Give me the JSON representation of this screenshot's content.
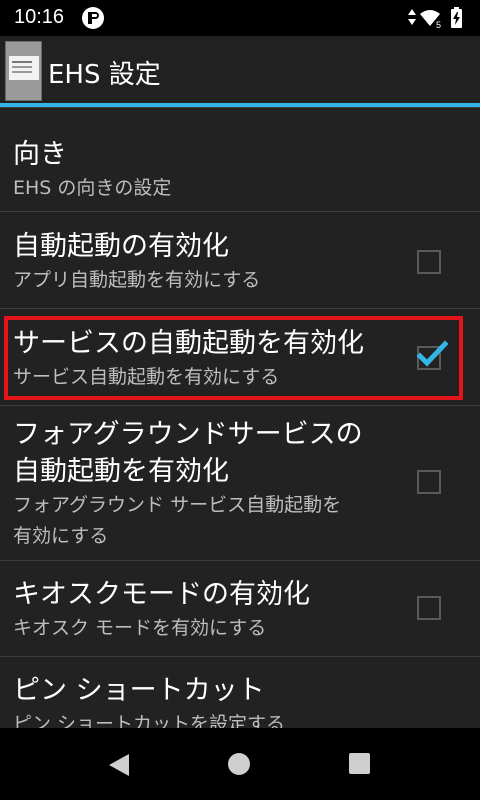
{
  "status_bar": {
    "time": "10:16"
  },
  "action_bar": {
    "title": "EHS 設定"
  },
  "settings": [
    {
      "title": "向き",
      "summary": "EHS の向きの設定"
    },
    {
      "title": "自動起動の有効化",
      "summary": "アプリ自動起動を有効にする",
      "checked": false
    },
    {
      "title": "サービスの自動起動を有効化",
      "summary": "サービス自動起動を有効にする",
      "checked": true
    },
    {
      "title_line1": "フォアグラウンドサービスの",
      "title_line2": "自動起動を有効化",
      "summary_line1": "フォアグラウンド サービス自動起動を",
      "summary_line2": "有効にする",
      "checked": false
    },
    {
      "title": "キオスクモードの有効化",
      "summary": "キオスク モードを有効にする",
      "checked": false
    },
    {
      "title": "ピン ショートカット",
      "summary": "ピン ショートカットを設定する"
    }
  ],
  "colors": {
    "accent": "#33b5e5",
    "highlight": "#e3151a",
    "checkmark": "#33b5e5"
  },
  "icons": {
    "back": "back-triangle-icon",
    "home": "home-circle-icon",
    "recents": "recents-square-icon"
  }
}
